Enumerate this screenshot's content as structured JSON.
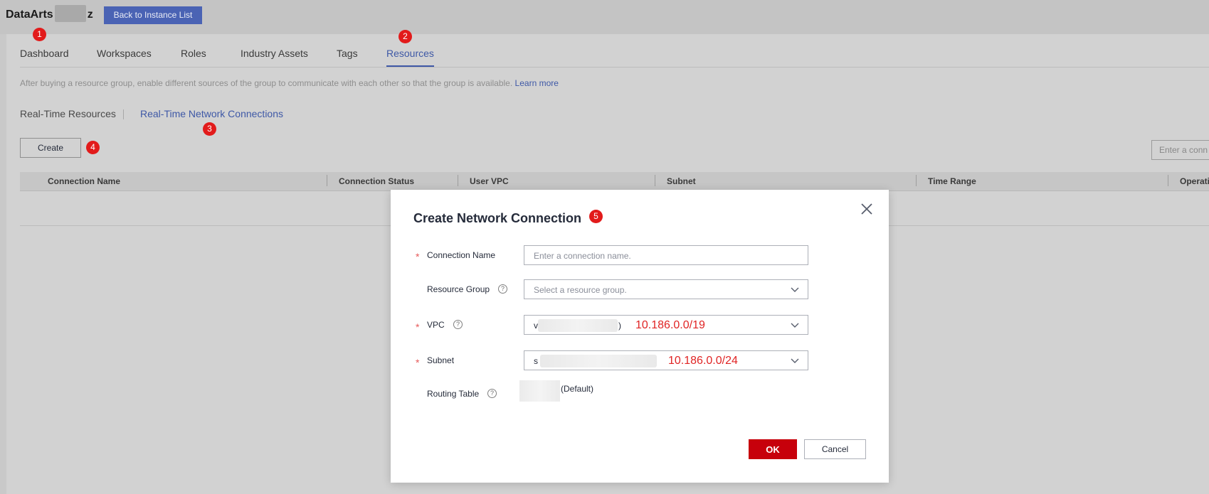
{
  "app": {
    "title_prefix": "DataArts",
    "title_suffix": "z",
    "back_button": "Back to Instance List"
  },
  "tabs": [
    {
      "label": "Dashboard",
      "active": false
    },
    {
      "label": "Workspaces",
      "active": false
    },
    {
      "label": "Roles",
      "active": false
    },
    {
      "label": "Industry Assets",
      "active": false
    },
    {
      "label": "Tags",
      "active": false
    },
    {
      "label": "Resources",
      "active": true
    }
  ],
  "info": {
    "text": "After buying a resource group, enable different sources of the group to communicate with each other so that the group is available.",
    "link": "Learn more"
  },
  "subtabs": [
    {
      "label": "Real-Time Resources",
      "active": false
    },
    {
      "label": "Real-Time Network Connections",
      "active": true
    }
  ],
  "toolbar": {
    "create_label": "Create",
    "search_placeholder": "Enter a conn"
  },
  "table": {
    "columns": [
      "Connection Name",
      "Connection Status",
      "User VPC",
      "Subnet",
      "Time Range",
      "Operatio"
    ]
  },
  "markers": [
    "1",
    "2",
    "3",
    "4",
    "5"
  ],
  "dialog": {
    "title": "Create Network Connection",
    "fields": {
      "connection_name": {
        "label": "Connection Name",
        "placeholder": "Enter a connection name."
      },
      "resource_group": {
        "label": "Resource Group",
        "placeholder": "Select a resource group."
      },
      "vpc": {
        "label": "VPC",
        "value_prefix": "v",
        "value_suffix": ")",
        "annotation": "10.186.0.0/19"
      },
      "subnet": {
        "label": "Subnet",
        "value_prefix": "s",
        "annotation": "10.186.0.0/24"
      },
      "routing_table": {
        "label": "Routing Table",
        "value": "(Default)"
      }
    },
    "help_glyph": "?",
    "ok_label": "OK",
    "cancel_label": "Cancel"
  },
  "colors": {
    "accent": "#3e58a6",
    "primary_button": "#c7000b",
    "marker": "#e21b1b",
    "annotation": "#e02424"
  }
}
